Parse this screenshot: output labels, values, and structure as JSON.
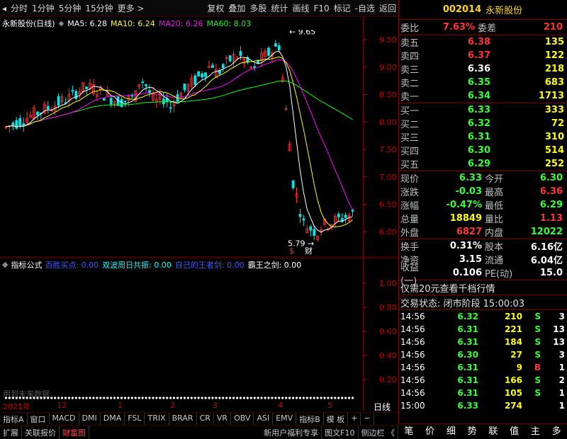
{
  "toolbar": {
    "left_icon": "◂",
    "items": [
      "分时",
      "1分钟",
      "5分钟",
      "15分钟",
      "更多 >"
    ],
    "actions": [
      "复权",
      "叠加",
      "多股",
      "统计",
      "画线",
      "F10",
      "标记",
      "-自选",
      "返回"
    ]
  },
  "stock": {
    "code": "002014",
    "name": "永新股份"
  },
  "ma": {
    "title": "永新股份(日线)",
    "ma5": "MA5: 6.28",
    "ma10": "MA10: 6.24",
    "ma20": "MA20: 6.26",
    "ma60": "MA60: 8.03"
  },
  "chart_data": {
    "type": "candlestick",
    "high_label": "9.65",
    "low_label": "5.79",
    "y_ticks": [
      "9.50",
      "9.00",
      "8.50",
      "8.00",
      "7.50",
      "7.00",
      "6.50",
      "6.00"
    ],
    "markers": [
      "$",
      "财"
    ],
    "colors": {
      "up": "#ff3333",
      "down": "#00e5e5",
      "ma5": "#ffffff",
      "ma10": "#ffff00",
      "ma20": "#ff00ff",
      "ma60": "#00ff00"
    }
  },
  "indicator": {
    "title": "指标公式",
    "items": [
      {
        "label": "百胜买点:",
        "value": "0.00",
        "color": "#3b5bff"
      },
      {
        "label": "双波周日共振:",
        "value": "0.00",
        "color": "#00ffff"
      },
      {
        "label": "自己的王者剑:",
        "value": "0.00",
        "color": "#3b5bff"
      },
      {
        "label": "霸王之剑:",
        "value": "0.00",
        "color": "#ffffff"
      }
    ],
    "y_ticks": [
      "1.00",
      "0.80",
      "0.60",
      "0.40",
      "0.20"
    ],
    "note": "用到未来数据"
  },
  "time_axis": [
    "2021年",
    "12",
    "1",
    "2",
    "3",
    "4",
    "5"
  ],
  "time_axis_right": "日线",
  "tabs_row1": [
    "指标A",
    "窗口",
    "MACD",
    "DMI",
    "DMA",
    "FSL",
    "TRIX",
    "BRAR",
    "CR",
    "VR",
    "OBV",
    "ASI",
    "EMV",
    "指标B",
    "模 板",
    "+",
    "−"
  ],
  "tabs_row2": [
    "扩展",
    "关联报价",
    "财富图",
    "新用户福利专享",
    "图文F10",
    "侧边栏 《"
  ],
  "panel": {
    "weibi": {
      "l": "委比",
      "v": "7.63%",
      "l2": "委差",
      "v2": "210"
    },
    "sells": [
      {
        "l": "卖五",
        "p": "6.38",
        "v": "135"
      },
      {
        "l": "卖四",
        "p": "6.37",
        "v": "122"
      },
      {
        "l": "卖三",
        "p": "6.36",
        "v": "218"
      },
      {
        "l": "卖二",
        "p": "6.35",
        "v": "683"
      },
      {
        "l": "卖一",
        "p": "6.34",
        "v": "1713"
      }
    ],
    "buys": [
      {
        "l": "买一",
        "p": "6.33",
        "v": "333"
      },
      {
        "l": "买二",
        "p": "6.32",
        "v": "72"
      },
      {
        "l": "买三",
        "p": "6.31",
        "v": "310"
      },
      {
        "l": "买四",
        "p": "6.30",
        "v": "514"
      },
      {
        "l": "买五",
        "p": "6.29",
        "v": "252"
      }
    ],
    "quote": [
      {
        "l": "现价",
        "v": "6.33",
        "l2": "今开",
        "v2": "6.30"
      },
      {
        "l": "涨跌",
        "v": "-0.03",
        "l2": "最高",
        "v2": "6.36"
      },
      {
        "l": "涨幅",
        "v": "-0.47%",
        "l2": "最低",
        "v2": "6.29"
      },
      {
        "l": "总量",
        "v": "18849",
        "l2": "量比",
        "v2": "1.13"
      },
      {
        "l": "外盘",
        "v": "6827",
        "l2": "内盘",
        "v2": "12022"
      }
    ],
    "stats": [
      {
        "l": "换手",
        "v": "0.31%",
        "l2": "股本",
        "v2": "6.16亿"
      },
      {
        "l": "净资",
        "v": "3.15",
        "l2": "流通",
        "v2": "6.04亿"
      },
      {
        "l": "收益(一)",
        "v": "0.106",
        "l2": "PE(动)",
        "v2": "15.0"
      }
    ],
    "promo": "仅需20元查看千档行情",
    "status": "交易状态: 闭市阶段 15:00:03",
    "ticks": [
      {
        "t": "14:56",
        "p": "6.32",
        "v": "210",
        "s": "S",
        "n": "3"
      },
      {
        "t": "14:56",
        "p": "6.31",
        "v": "221",
        "s": "S",
        "n": "13"
      },
      {
        "t": "14:56",
        "p": "6.31",
        "v": "184",
        "s": "S",
        "n": "13"
      },
      {
        "t": "14:56",
        "p": "6.30",
        "v": "27",
        "s": "S",
        "n": "3"
      },
      {
        "t": "14:56",
        "p": "6.31",
        "v": "9",
        "s": "B",
        "n": "1"
      },
      {
        "t": "14:56",
        "p": "6.31",
        "v": "166",
        "s": "S",
        "n": "2"
      },
      {
        "t": "14:56",
        "p": "6.31",
        "v": "105",
        "s": "S",
        "n": "1"
      },
      {
        "t": "15:00",
        "p": "6.33",
        "v": "274",
        "s": "",
        "n": "1"
      }
    ],
    "bottom": [
      "笔",
      "价",
      "细",
      "势",
      "联",
      "值",
      "主",
      "多"
    ]
  }
}
